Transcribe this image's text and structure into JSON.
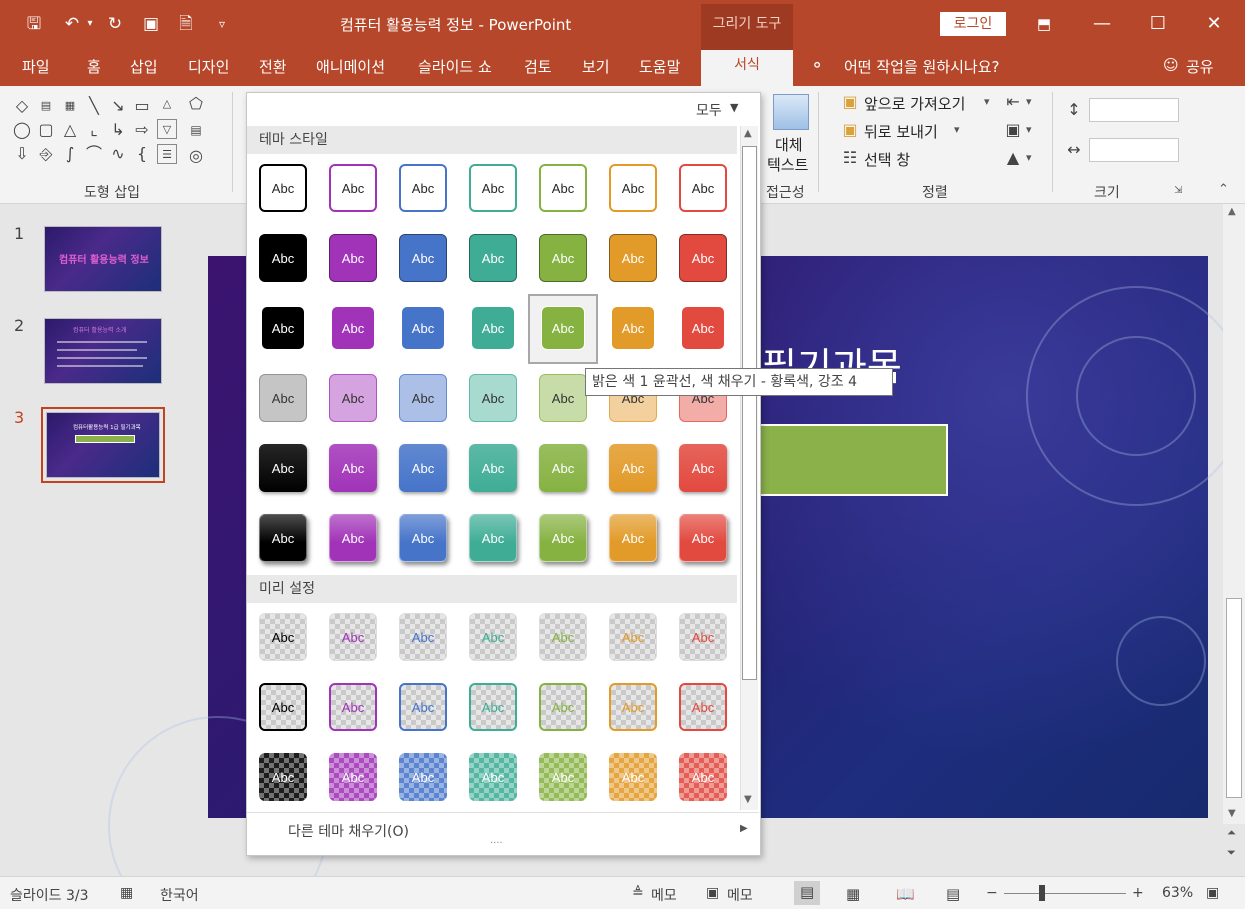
{
  "window": {
    "title": "컴퓨터 활용능력 정보  -  PowerPoint",
    "contextual_tab": "그리기 도구",
    "login": "로그인",
    "icons": [
      "save-icon",
      "undo-icon",
      "redo-icon",
      "slideshow-icon",
      "new-doc-icon",
      "qat-customize-icon",
      "ribbon-display-icon",
      "minimize-icon",
      "maximize-icon",
      "close-icon"
    ]
  },
  "tabs": [
    "파일",
    "홈",
    "삽입",
    "디자인",
    "전환",
    "애니메이션",
    "슬라이드 쇼",
    "검토",
    "보기",
    "도움말",
    "서식"
  ],
  "tell_me": "어떤 작업을 원하시나요?",
  "share": "공유",
  "ribbon": {
    "insert_shapes_label": "도형 삽입",
    "alt_text_line1": "대체",
    "alt_text_line2": "텍스트",
    "accessibility_label": "접근성",
    "bring_forward": "앞으로 가져오기",
    "send_backward": "뒤로 보내기",
    "selection_pane": "선택 창",
    "arrange_label": "정렬",
    "size_label": "크기"
  },
  "gallery": {
    "filter": "모두",
    "theme_section": "테마 스타일",
    "preset_section": "미리 설정",
    "swatch_text": "Abc",
    "more_fills": "다른 테마 채우기(O)",
    "tooltip": "밝은 색 1 윤곽선, 색 채우기 - 황록색, 강조 4",
    "accent_colors": [
      "#262626",
      "#a133b8",
      "#4674c9",
      "#3fad96",
      "#86b242",
      "#e29a28",
      "#e2493f"
    ]
  },
  "slides": {
    "numbers": [
      "1",
      "2",
      "3"
    ],
    "selected": 3,
    "thumb1_title": "컴퓨터 활용능력 정보",
    "thumb2_title": "컴퓨터 활용능력 소개",
    "thumb3_title": "컴퓨터활용능력 1급 필기과목"
  },
  "slide": {
    "title_fragment": "필기과목"
  },
  "status": {
    "slide_counter": "슬라이드 3/3",
    "language": "한국어",
    "notes1": "메모",
    "notes2": "메모",
    "zoom": "63%",
    "zoom_percent": 63
  }
}
